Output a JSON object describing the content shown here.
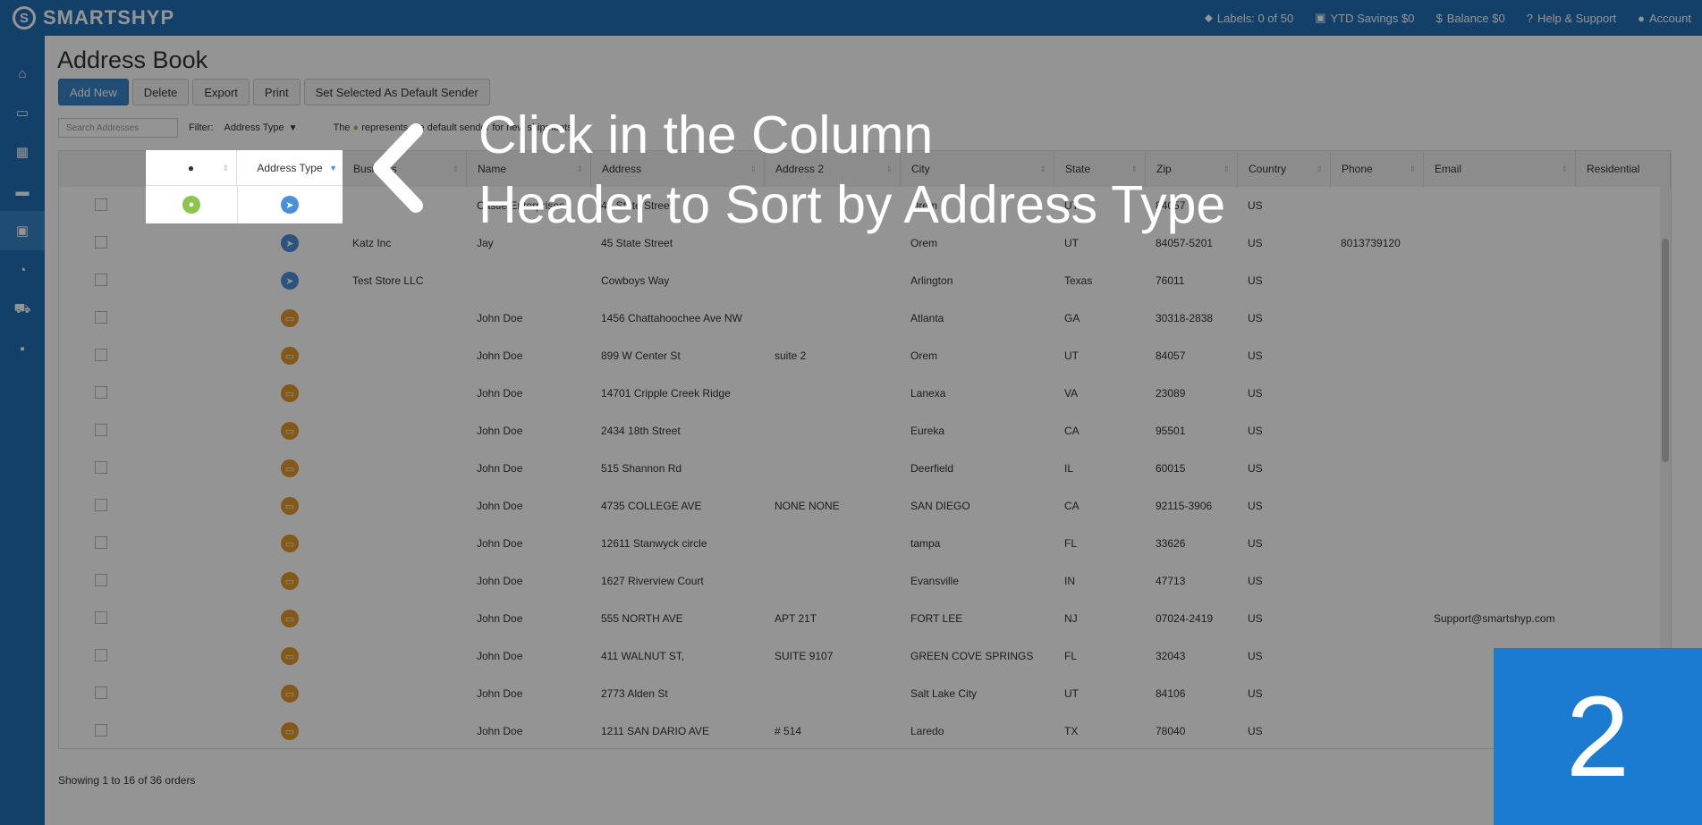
{
  "brand": {
    "name": "SMARTSHYP"
  },
  "header": {
    "labels": "Labels: 0 of 50",
    "ytd_savings": "YTD Savings $0",
    "balance": "Balance $0",
    "help": "Help & Support",
    "account": "Account"
  },
  "sidebar": {
    "items": [
      {
        "icon": "home-icon",
        "glyph": "⌂"
      },
      {
        "icon": "basket-icon",
        "glyph": "▭"
      },
      {
        "icon": "calendar-icon",
        "glyph": "▦"
      },
      {
        "icon": "truck-icon",
        "glyph": "▬"
      },
      {
        "icon": "address-book-icon",
        "glyph": "▣"
      },
      {
        "icon": "pie-chart-icon",
        "glyph": "◔"
      },
      {
        "icon": "cart-icon",
        "glyph": "⛟"
      },
      {
        "icon": "lock-icon",
        "glyph": "▪"
      }
    ]
  },
  "page": {
    "title": "Address Book"
  },
  "toolbar": {
    "add_new": "Add New",
    "delete": "Delete",
    "export": "Export",
    "print": "Print",
    "set_default": "Set Selected As Default Sender"
  },
  "filter": {
    "search_placeholder": "Search Addresses",
    "label": "Filter:",
    "selected": "Address Type",
    "note_prefix": "The",
    "note_suffix": "represents the default sender for new shipments"
  },
  "table": {
    "columns": [
      "",
      "",
      "Address Type",
      "Business",
      "Name",
      "Address",
      "Address 2",
      "City",
      "State",
      "Zip",
      "Country",
      "Phone",
      "Email",
      "Residential"
    ],
    "rows": [
      {
        "type": "default",
        "business": "",
        "name": "Castle Enterprises",
        "address": "45 State Street",
        "address2": "",
        "city": "Orem",
        "state": "UT",
        "zip": "84057",
        "country": "US",
        "phone": "",
        "email": "",
        "residential": ""
      },
      {
        "type": "sender",
        "business": "Katz Inc",
        "name": "Jay",
        "address": "45 State Street",
        "address2": "",
        "city": "Orem",
        "state": "UT",
        "zip": "84057-5201",
        "country": "US",
        "phone": "8013739120",
        "email": "",
        "residential": ""
      },
      {
        "type": "sender",
        "business": "Test Store LLC",
        "name": "",
        "address": "Cowboys Way",
        "address2": "",
        "city": "Arlington",
        "state": "Texas",
        "zip": "76011",
        "country": "US",
        "phone": "",
        "email": "",
        "residential": ""
      },
      {
        "type": "recipient",
        "business": "",
        "name": "John Doe",
        "address": "1456 Chattahoochee Ave NW",
        "address2": "",
        "city": "Atlanta",
        "state": "GA",
        "zip": "30318-2838",
        "country": "US",
        "phone": "",
        "email": "",
        "residential": ""
      },
      {
        "type": "recipient",
        "business": "",
        "name": "John Doe",
        "address": "899 W Center St",
        "address2": "suite 2",
        "city": "Orem",
        "state": "UT",
        "zip": "84057",
        "country": "US",
        "phone": "",
        "email": "",
        "residential": ""
      },
      {
        "type": "recipient",
        "business": "",
        "name": "John Doe",
        "address": "14701 Cripple Creek Ridge",
        "address2": "",
        "city": "Lanexa",
        "state": "VA",
        "zip": "23089",
        "country": "US",
        "phone": "",
        "email": "",
        "residential": ""
      },
      {
        "type": "recipient",
        "business": "",
        "name": "John Doe",
        "address": "2434 18th Street",
        "address2": "",
        "city": "Eureka",
        "state": "CA",
        "zip": "95501",
        "country": "US",
        "phone": "",
        "email": "",
        "residential": ""
      },
      {
        "type": "recipient",
        "business": "",
        "name": "John Doe",
        "address": "515 Shannon Rd",
        "address2": "",
        "city": "Deerfield",
        "state": "IL",
        "zip": "60015",
        "country": "US",
        "phone": "",
        "email": "",
        "residential": ""
      },
      {
        "type": "recipient",
        "business": "",
        "name": "John Doe",
        "address": "4735 COLLEGE AVE",
        "address2": "NONE NONE",
        "city": "SAN DIEGO",
        "state": "CA",
        "zip": "92115-3906",
        "country": "US",
        "phone": "",
        "email": "",
        "residential": ""
      },
      {
        "type": "recipient",
        "business": "",
        "name": "John Doe",
        "address": "12611 Stanwyck circle",
        "address2": "",
        "city": "tampa",
        "state": "FL",
        "zip": "33626",
        "country": "US",
        "phone": "",
        "email": "",
        "residential": ""
      },
      {
        "type": "recipient",
        "business": "",
        "name": "John Doe",
        "address": "1627 Riverview Court",
        "address2": "",
        "city": "Evansville",
        "state": "IN",
        "zip": "47713",
        "country": "US",
        "phone": "",
        "email": "",
        "residential": ""
      },
      {
        "type": "recipient",
        "business": "",
        "name": "John Doe",
        "address": "555 NORTH AVE",
        "address2": "APT 21T",
        "city": "FORT LEE",
        "state": "NJ",
        "zip": "07024-2419",
        "country": "US",
        "phone": "",
        "email": "Support@smartshyp.com",
        "residential": ""
      },
      {
        "type": "recipient",
        "business": "",
        "name": "John Doe",
        "address": "411 WALNUT ST,",
        "address2": "SUITE 9107",
        "city": "GREEN COVE SPRINGS",
        "state": "FL",
        "zip": "32043",
        "country": "US",
        "phone": "",
        "email": "",
        "residential": ""
      },
      {
        "type": "recipient",
        "business": "",
        "name": "John Doe",
        "address": "2773 Alden St",
        "address2": "",
        "city": "Salt Lake City",
        "state": "UT",
        "zip": "84106",
        "country": "US",
        "phone": "",
        "email": "",
        "residential": ""
      },
      {
        "type": "recipient",
        "business": "",
        "name": "John Doe",
        "address": "1211 SAN DARIO AVE",
        "address2": "# 514",
        "city": "Laredo",
        "state": "TX",
        "zip": "78040",
        "country": "US",
        "phone": "",
        "email": "",
        "residential": ""
      }
    ]
  },
  "footer": {
    "showing": "Showing 1 to 16 of 36 orders"
  },
  "tutorial": {
    "callout_line1": "Click in the Column",
    "callout_line2": "Header to Sort by Address Type",
    "step": "2"
  },
  "colors": {
    "brand": "#1f6fb5",
    "default_badge": "#8dc44e",
    "sender_badge": "#4a90d9",
    "recipient_badge": "#e09a2b",
    "step_box": "#1a7bd0"
  }
}
